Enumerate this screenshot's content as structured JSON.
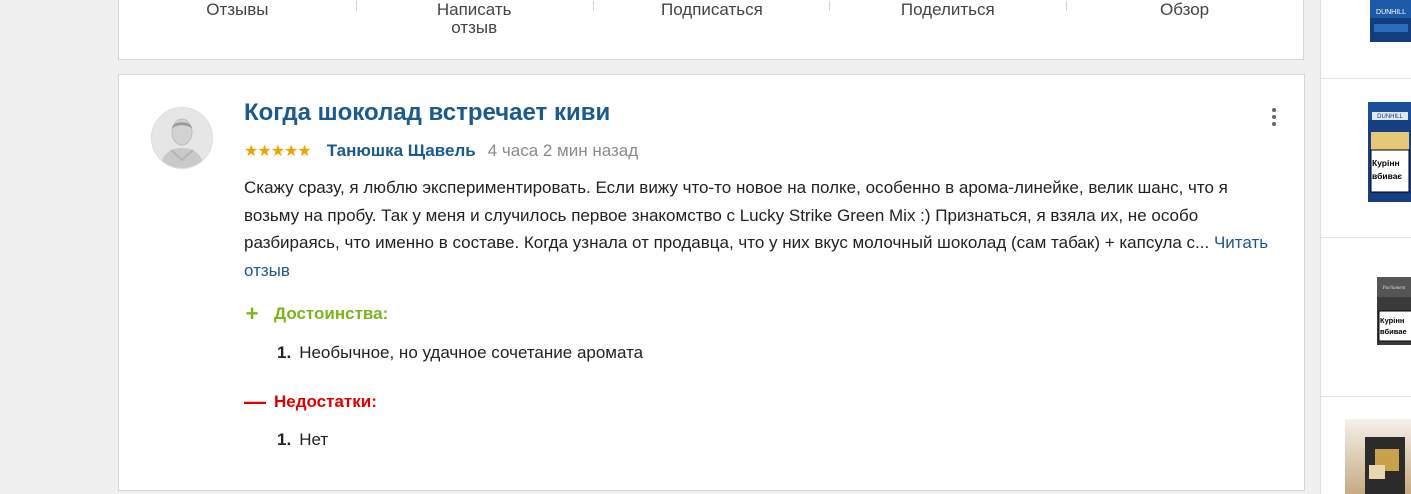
{
  "top_actions": [
    {
      "label": "Отзывы"
    },
    {
      "label": "Написать отзыв"
    },
    {
      "label": "Подписаться"
    },
    {
      "label": "Поделиться"
    },
    {
      "label": "Обзор"
    }
  ],
  "review": {
    "title": "Когда шоколад встречает киви",
    "stars": "★★★★★",
    "author": "Танюшка Щавель",
    "time": "4 часа 2 мин назад",
    "text": "Скажу сразу, я люблю экспериментировать. Если вижу что-то новое на полке, особенно в арома-линейке, велик шанс, что я возьму на пробу. Так у меня и случилось первое знакомство с Lucky Strike Green Mix :) Признаться, я взяла их, не особо разбираясь, что именно в составе. Когда узнала от продавца, что у них вкус молочный шоколад (сам табак) + капсула с...",
    "read_more": "Читать отзыв",
    "pros_label": "Достоинства:",
    "pros": [
      {
        "num": "1.",
        "text": "Необычное, но удачное сочетание аромата"
      }
    ],
    "cons_label": "Недостатки:",
    "cons": [
      {
        "num": "1.",
        "text": "Нет"
      }
    ],
    "plus_sign": "+",
    "minus_sign": "—"
  },
  "sidebar": {
    "products": [
      {
        "brand": "DUNHILL"
      },
      {
        "brand": "DUNHILL",
        "warning": "Курінн вбиває"
      },
      {
        "brand": "",
        "warning": "Курінн вбивае"
      },
      {
        "brand": ""
      }
    ]
  },
  "colors": {
    "link": "#1a5a8c",
    "star": "#f2a200",
    "pros": "#7cb51a",
    "cons": "#e00000"
  }
}
